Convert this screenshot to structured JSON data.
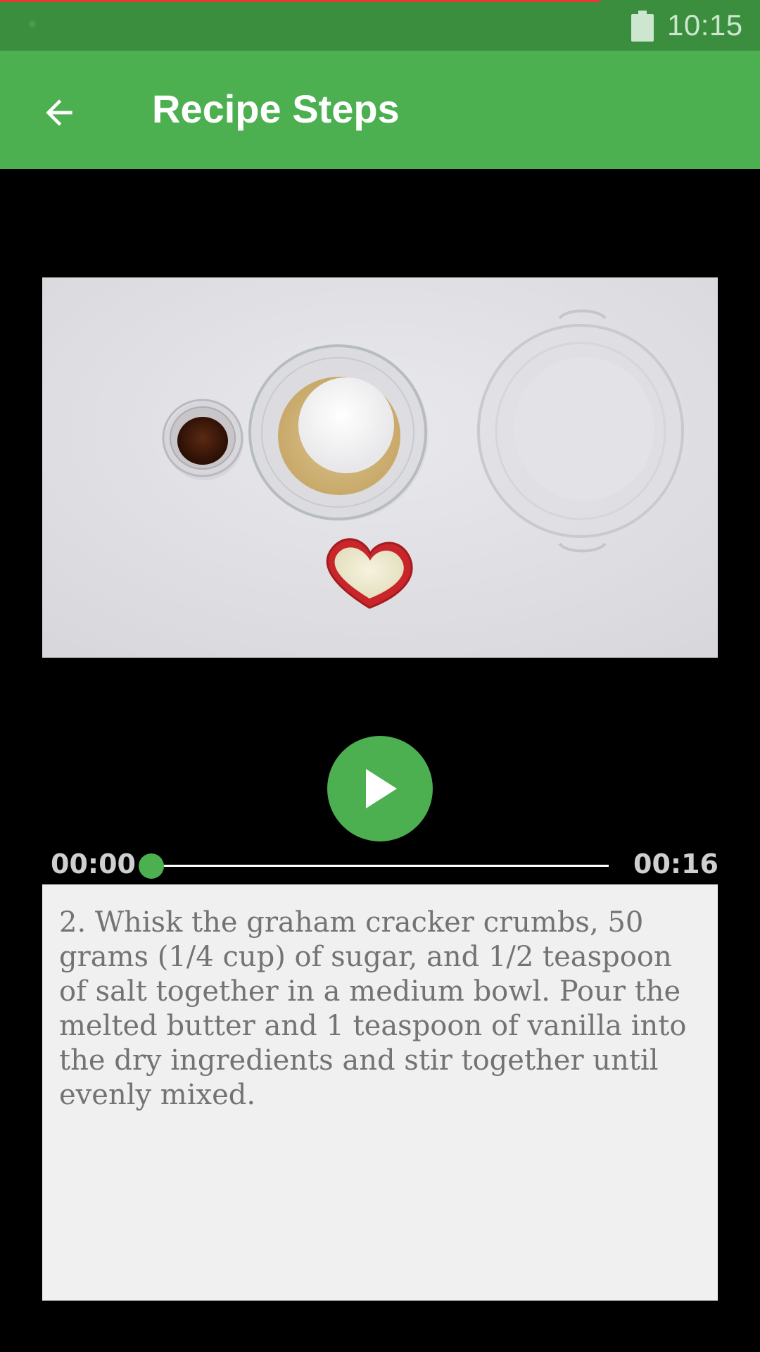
{
  "status_bar": {
    "time": "10:15",
    "battery_icon": "battery-icon",
    "top_line_color": "#e53935"
  },
  "app_bar": {
    "title": "Recipe Steps",
    "back_icon": "arrow-left-icon",
    "color": "#4caf50"
  },
  "player": {
    "play_icon": "play-icon",
    "current_time": "00:00",
    "total_time": "00:16",
    "progress": 0.0,
    "accent_color": "#4caf50"
  },
  "step": {
    "description": "2. Whisk the graham cracker crumbs, 50 grams (1/4 cup) of sugar, and 1/2 teaspoon of salt together in a medium bowl. Pour the melted butter and 1 teaspoon of vanilla into the dry ingredients and stir together until evenly mixed."
  }
}
